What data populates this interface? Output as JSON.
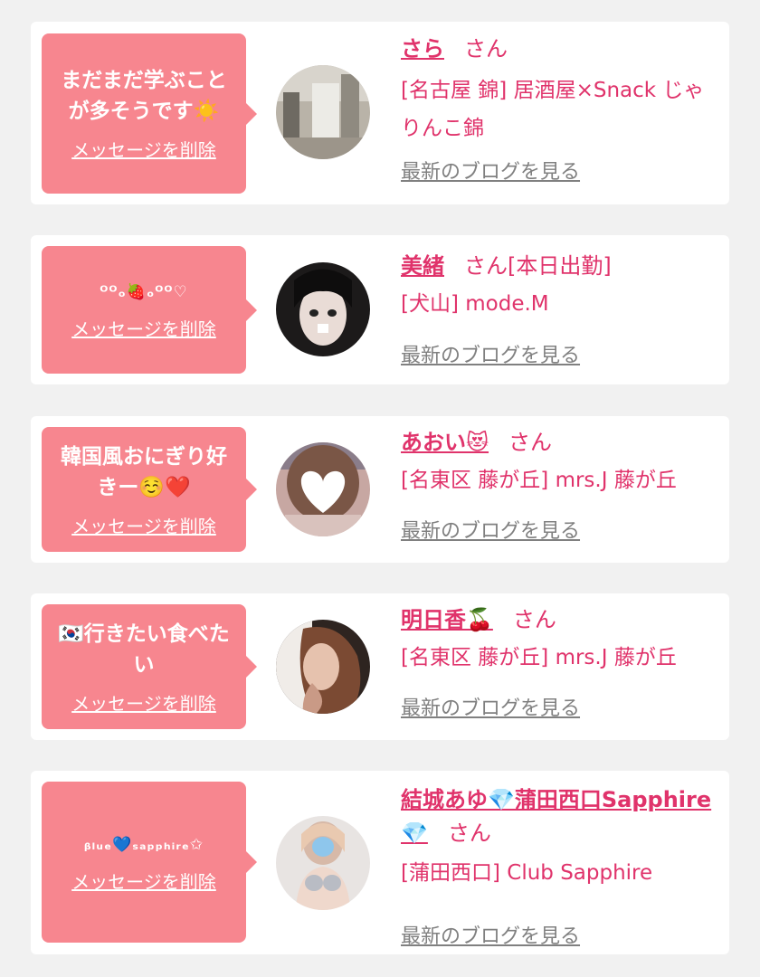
{
  "common": {
    "delete_label": "メッセージを削除",
    "blog_label": "最新のブログを見る",
    "san": "さん"
  },
  "cards": [
    {
      "message": "まだまだ学ぶことが多そうです☀️",
      "name": "さら",
      "name_suffix": "",
      "shop": "[名古屋 錦] 居酒屋×Snack じゃりんこ錦"
    },
    {
      "message": "ᴼᴼₒ🍓ₒᴼᴼ♡",
      "name": "美緒",
      "name_suffix": "[本日出勤]",
      "shop": "[犬山] mode.M"
    },
    {
      "message": "韓国風おにぎり好きー☺️❤️",
      "name": "あおい😻",
      "name_suffix": "",
      "shop": "[名東区 藤が丘] mrs.J 藤が丘"
    },
    {
      "message": "🇰🇷行きたい食べたい",
      "name": "明日香🍒",
      "name_suffix": "",
      "shop": "[名東区 藤が丘] mrs.J 藤が丘"
    },
    {
      "message": "ᵦₗᵤₑ💙ₛₐₚₚₕᵢᵣₑ✩",
      "name": "結城あゆ💎蒲田西口Sapphire💎",
      "name_suffix": "",
      "shop": "[蒲田西口] Club Sapphire"
    }
  ],
  "colors": {
    "bubble": "#f7868f",
    "name": "#e0336b",
    "blog": "#808080",
    "background": "#f1f1f1"
  }
}
